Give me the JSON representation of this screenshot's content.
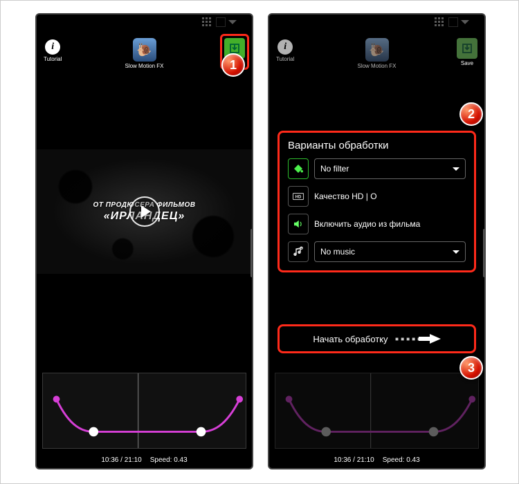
{
  "topbar": {
    "tutorial_label": "Tutorial",
    "app_label": "Slow Motion FX",
    "save_label": "Save"
  },
  "video": {
    "line1": "ОТ ПРОДЮСЕРА ФИЛЬМОВ",
    "line2": "«ИРЛАНДЕЦ»"
  },
  "status": {
    "time": "10:36 / 21:10",
    "speed": "Speed: 0.43"
  },
  "panel": {
    "title": "Варианты обработки",
    "filter": "No filter",
    "quality": "Качество HD | О",
    "audio": "Включить аудио из фильма",
    "music": "No music"
  },
  "start": {
    "label": "Начать обработку"
  },
  "badges": {
    "b1": "1",
    "b2": "2",
    "b3": "3"
  },
  "curve": {
    "handles": [
      {
        "x": 0.07,
        "y": 0.35
      },
      {
        "x": 0.25,
        "y": 0.78
      },
      {
        "x": 0.78,
        "y": 0.78
      },
      {
        "x": 0.97,
        "y": 0.35
      }
    ],
    "playhead_x": 0.47
  }
}
